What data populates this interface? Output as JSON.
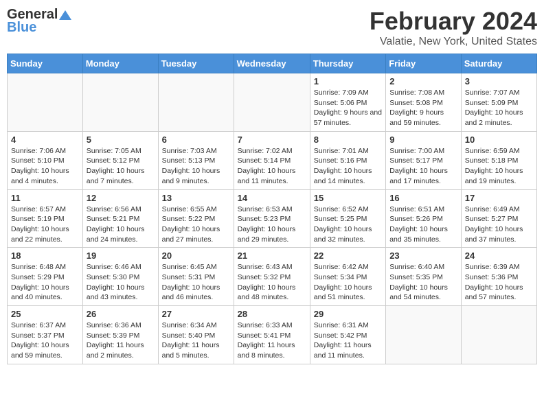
{
  "header": {
    "logo_general": "General",
    "logo_blue": "Blue",
    "month": "February 2024",
    "location": "Valatie, New York, United States"
  },
  "days_of_week": [
    "Sunday",
    "Monday",
    "Tuesday",
    "Wednesday",
    "Thursday",
    "Friday",
    "Saturday"
  ],
  "weeks": [
    [
      {
        "num": "",
        "info": ""
      },
      {
        "num": "",
        "info": ""
      },
      {
        "num": "",
        "info": ""
      },
      {
        "num": "",
        "info": ""
      },
      {
        "num": "1",
        "info": "Sunrise: 7:09 AM\nSunset: 5:06 PM\nDaylight: 9 hours and 57 minutes."
      },
      {
        "num": "2",
        "info": "Sunrise: 7:08 AM\nSunset: 5:08 PM\nDaylight: 9 hours and 59 minutes."
      },
      {
        "num": "3",
        "info": "Sunrise: 7:07 AM\nSunset: 5:09 PM\nDaylight: 10 hours and 2 minutes."
      }
    ],
    [
      {
        "num": "4",
        "info": "Sunrise: 7:06 AM\nSunset: 5:10 PM\nDaylight: 10 hours and 4 minutes."
      },
      {
        "num": "5",
        "info": "Sunrise: 7:05 AM\nSunset: 5:12 PM\nDaylight: 10 hours and 7 minutes."
      },
      {
        "num": "6",
        "info": "Sunrise: 7:03 AM\nSunset: 5:13 PM\nDaylight: 10 hours and 9 minutes."
      },
      {
        "num": "7",
        "info": "Sunrise: 7:02 AM\nSunset: 5:14 PM\nDaylight: 10 hours and 11 minutes."
      },
      {
        "num": "8",
        "info": "Sunrise: 7:01 AM\nSunset: 5:16 PM\nDaylight: 10 hours and 14 minutes."
      },
      {
        "num": "9",
        "info": "Sunrise: 7:00 AM\nSunset: 5:17 PM\nDaylight: 10 hours and 17 minutes."
      },
      {
        "num": "10",
        "info": "Sunrise: 6:59 AM\nSunset: 5:18 PM\nDaylight: 10 hours and 19 minutes."
      }
    ],
    [
      {
        "num": "11",
        "info": "Sunrise: 6:57 AM\nSunset: 5:19 PM\nDaylight: 10 hours and 22 minutes."
      },
      {
        "num": "12",
        "info": "Sunrise: 6:56 AM\nSunset: 5:21 PM\nDaylight: 10 hours and 24 minutes."
      },
      {
        "num": "13",
        "info": "Sunrise: 6:55 AM\nSunset: 5:22 PM\nDaylight: 10 hours and 27 minutes."
      },
      {
        "num": "14",
        "info": "Sunrise: 6:53 AM\nSunset: 5:23 PM\nDaylight: 10 hours and 29 minutes."
      },
      {
        "num": "15",
        "info": "Sunrise: 6:52 AM\nSunset: 5:25 PM\nDaylight: 10 hours and 32 minutes."
      },
      {
        "num": "16",
        "info": "Sunrise: 6:51 AM\nSunset: 5:26 PM\nDaylight: 10 hours and 35 minutes."
      },
      {
        "num": "17",
        "info": "Sunrise: 6:49 AM\nSunset: 5:27 PM\nDaylight: 10 hours and 37 minutes."
      }
    ],
    [
      {
        "num": "18",
        "info": "Sunrise: 6:48 AM\nSunset: 5:29 PM\nDaylight: 10 hours and 40 minutes."
      },
      {
        "num": "19",
        "info": "Sunrise: 6:46 AM\nSunset: 5:30 PM\nDaylight: 10 hours and 43 minutes."
      },
      {
        "num": "20",
        "info": "Sunrise: 6:45 AM\nSunset: 5:31 PM\nDaylight: 10 hours and 46 minutes."
      },
      {
        "num": "21",
        "info": "Sunrise: 6:43 AM\nSunset: 5:32 PM\nDaylight: 10 hours and 48 minutes."
      },
      {
        "num": "22",
        "info": "Sunrise: 6:42 AM\nSunset: 5:34 PM\nDaylight: 10 hours and 51 minutes."
      },
      {
        "num": "23",
        "info": "Sunrise: 6:40 AM\nSunset: 5:35 PM\nDaylight: 10 hours and 54 minutes."
      },
      {
        "num": "24",
        "info": "Sunrise: 6:39 AM\nSunset: 5:36 PM\nDaylight: 10 hours and 57 minutes."
      }
    ],
    [
      {
        "num": "25",
        "info": "Sunrise: 6:37 AM\nSunset: 5:37 PM\nDaylight: 10 hours and 59 minutes."
      },
      {
        "num": "26",
        "info": "Sunrise: 6:36 AM\nSunset: 5:39 PM\nDaylight: 11 hours and 2 minutes."
      },
      {
        "num": "27",
        "info": "Sunrise: 6:34 AM\nSunset: 5:40 PM\nDaylight: 11 hours and 5 minutes."
      },
      {
        "num": "28",
        "info": "Sunrise: 6:33 AM\nSunset: 5:41 PM\nDaylight: 11 hours and 8 minutes."
      },
      {
        "num": "29",
        "info": "Sunrise: 6:31 AM\nSunset: 5:42 PM\nDaylight: 11 hours and 11 minutes."
      },
      {
        "num": "",
        "info": ""
      },
      {
        "num": "",
        "info": ""
      }
    ]
  ]
}
